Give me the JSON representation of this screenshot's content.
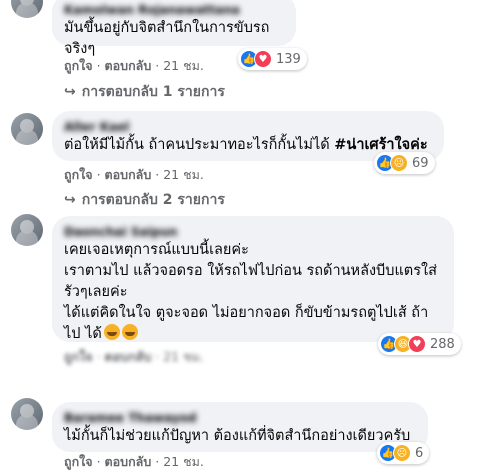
{
  "comments": [
    {
      "name": "Kamolwan Rojanawattana",
      "text": "มันขึ้นอยู่กับจิตสำนึกในการขับรถจริงๆ",
      "reactions": {
        "count": "139",
        "icons": [
          "like",
          "love"
        ]
      },
      "actions": {
        "like": "ถูกใจ",
        "reply": "ตอบกลับ",
        "time": "21 ชม."
      },
      "replies": "การตอบกลับ 1 รายการ"
    },
    {
      "name": "Aller Kael",
      "text": "ต่อให้มีไม้กั้น ถ้าคนประมาทอะไรก็กั้นไม่ได้ ",
      "hashtag": "#น่าเศร้าใจค่ะ",
      "reactions": {
        "count": "69",
        "icons": [
          "like",
          "sad"
        ]
      },
      "actions": {
        "like": "ถูกใจ",
        "reply": "ตอบกลับ",
        "time": "21 ชม."
      },
      "replies": "การตอบกลับ 2 รายการ"
    },
    {
      "name": "Daonchai Saipun",
      "text": "เคยเจอเหตุการณ์แบบนี้เลยค่ะ\nเราตามไป แล้วจอดรอ ให้รถไฟไปก่อน รถด้านหลังบีบแตรใส่ รัวๆเลยค่ะ\nได้แต่คิดในใจ ตูจะจอด ไม่อยากจอด ก็ขับข้ามรถตูไปเส้ ถ้าไป ได้",
      "emojis": [
        "grin-emoji",
        "laugh-emoji"
      ],
      "reactions": {
        "count": "288",
        "icons": [
          "like",
          "haha",
          "love"
        ]
      },
      "actions": {
        "like": "ถูกใจ",
        "reply": "ตอบกลับ",
        "time": "21 ชม."
      }
    },
    {
      "name": "Baramee Thawayod",
      "text": "ไม้กั้นก็ไม่ช่วยแก้ปัญหา ต้องแก้ที่จิตสำนึกอย่างเดียวครับ",
      "reactions": {
        "count": "6",
        "icons": [
          "like",
          "sad"
        ]
      },
      "actions": {
        "like": "ถูกใจ",
        "reply": "ตอบกลับ",
        "time": "21 ชม."
      }
    }
  ],
  "separator": "·",
  "colors": {
    "bubble": "#f0f2f5",
    "muted": "#65676b",
    "like": "#1877f2",
    "love": "#f33e58",
    "sad": "#f7b125"
  }
}
